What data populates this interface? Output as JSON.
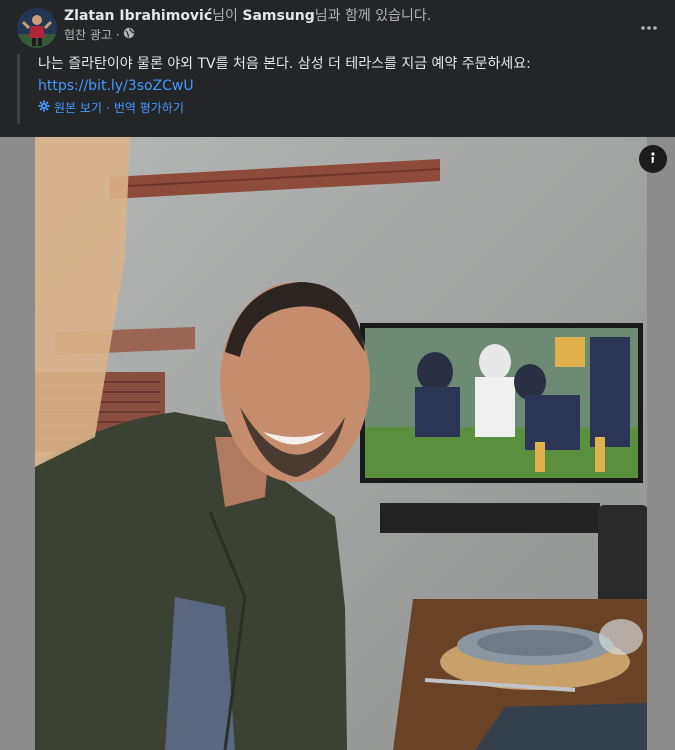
{
  "post": {
    "author": "Zlatan Ibrahimović",
    "author_suffix": "님이 ",
    "page": "Samsung",
    "page_suffix": "님과 함께 있습니다.",
    "sponsored_label": "협찬 광고 ·",
    "body_text": "나는 즐라탄이야 물론 야외 TV를 처음 본다. 삼성 더 테라스를 지금 예약 주문하세요:",
    "link": "https://bit.ly/3soZCwU",
    "see_original": "원본 보기",
    "separator": " · ",
    "rate_translation": "번역 평가하기"
  },
  "icons": {
    "privacy": "globe-icon",
    "more": "more-options-icon",
    "translate": "gear-icon",
    "info": "info-icon"
  },
  "colors": {
    "background": "#242526",
    "text": "#e4e6eb",
    "secondary": "#b0b3b8",
    "link": "#4599ff",
    "media_bg": "#8c8c8c"
  }
}
